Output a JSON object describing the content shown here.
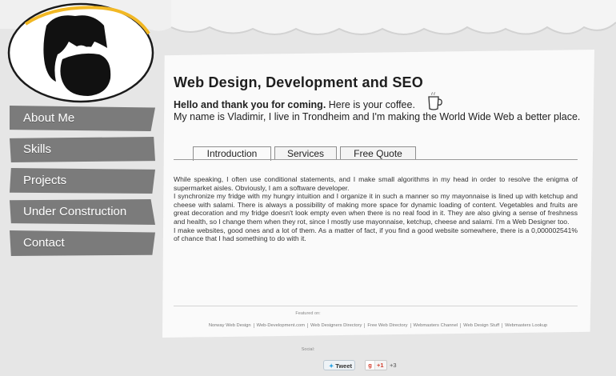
{
  "nav": {
    "items": [
      {
        "label": "About Me"
      },
      {
        "label": "Skills"
      },
      {
        "label": "Projects"
      },
      {
        "label": "Under Construction"
      },
      {
        "label": "Contact"
      }
    ]
  },
  "main": {
    "title": "Web Design, Development and SEO",
    "greeting_bold": "Hello and thank you for coming.",
    "greeting_rest": " Here is your coffee.",
    "intro_line": "My name is Vladimir, I live in Trondheim and I'm making the World Wide Web a better place.",
    "tabs": [
      {
        "label": "Introduction",
        "active": true
      },
      {
        "label": "Services",
        "active": false
      },
      {
        "label": "Free Quote",
        "active": false
      }
    ],
    "paragraphs": [
      "While speaking, I often use conditional statements, and I make small algorithms in my head in order to resolve the enigma of supermarket aisles. Obviously, I am a software developer.",
      "I synchronize my fridge with my hungry intuition and I organize it in such a manner so my mayonnaise is lined up with ketchup and cheese with salami. There is always a possibility of making more space for dynamic loading of content. Vegetables and fruits are great decoration and my fridge doesn't look empty even when there is no real food in it. They are also giving a sense of freshness and health, so I change them when they rot, since I mostly use mayonnaise, ketchup, cheese and salami. I'm a Web Designer too.",
      "I make websites, good ones and a lot of them. As a matter of fact, if you find a good website somewhere, there is a 0,000002541% of chance that I had something to do with it."
    ]
  },
  "footer": {
    "featured_label": "Featured on:",
    "links": [
      "Norway Web Design",
      "Web-Development.com",
      "Web Designers Directory",
      "Free Web Directory",
      "Webmasters Channel",
      "Web Design Stuff",
      "Webmasters Lookup"
    ],
    "social_label": "Social:",
    "tweet_label": "Tweet",
    "gplus_label": "+1",
    "gplus_count": "+3"
  },
  "icons": {
    "logo": "bearded-face-logo-icon",
    "coffee": "coffee-cup-icon",
    "twitter": "twitter-bird-icon",
    "gplus": "google-plus-icon"
  },
  "colors": {
    "nav_bg": "#7b7b7b",
    "page_bg": "#e6e6e6",
    "panel_bg": "#fafafa",
    "logo_ring": "#f2b824"
  }
}
